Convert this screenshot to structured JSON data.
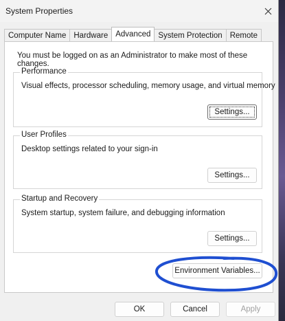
{
  "window": {
    "title": "System Properties"
  },
  "tabs": [
    "Computer Name",
    "Hardware",
    "Advanced",
    "System Protection",
    "Remote"
  ],
  "active_tab": "Advanced",
  "panel": {
    "admin_note": "You must be logged on as an Administrator to make most of these changes.",
    "performance": {
      "title": "Performance",
      "description": "Visual effects, processor scheduling, memory usage, and virtual memory",
      "button": "Settings..."
    },
    "user_profiles": {
      "title": "User Profiles",
      "description": "Desktop settings related to your sign-in",
      "button": "Settings..."
    },
    "startup_recovery": {
      "title": "Startup and Recovery",
      "description": "System startup, system failure, and debugging information",
      "button": "Settings..."
    },
    "environment_button": "Environment Variables..."
  },
  "footer": {
    "ok": "OK",
    "cancel": "Cancel",
    "apply": "Apply"
  },
  "colors": {
    "annotation": "#1f4fd1",
    "window_bg": "#f0f0f0",
    "panel_bg": "#ffffff"
  },
  "icons": {
    "close": "close-icon"
  }
}
